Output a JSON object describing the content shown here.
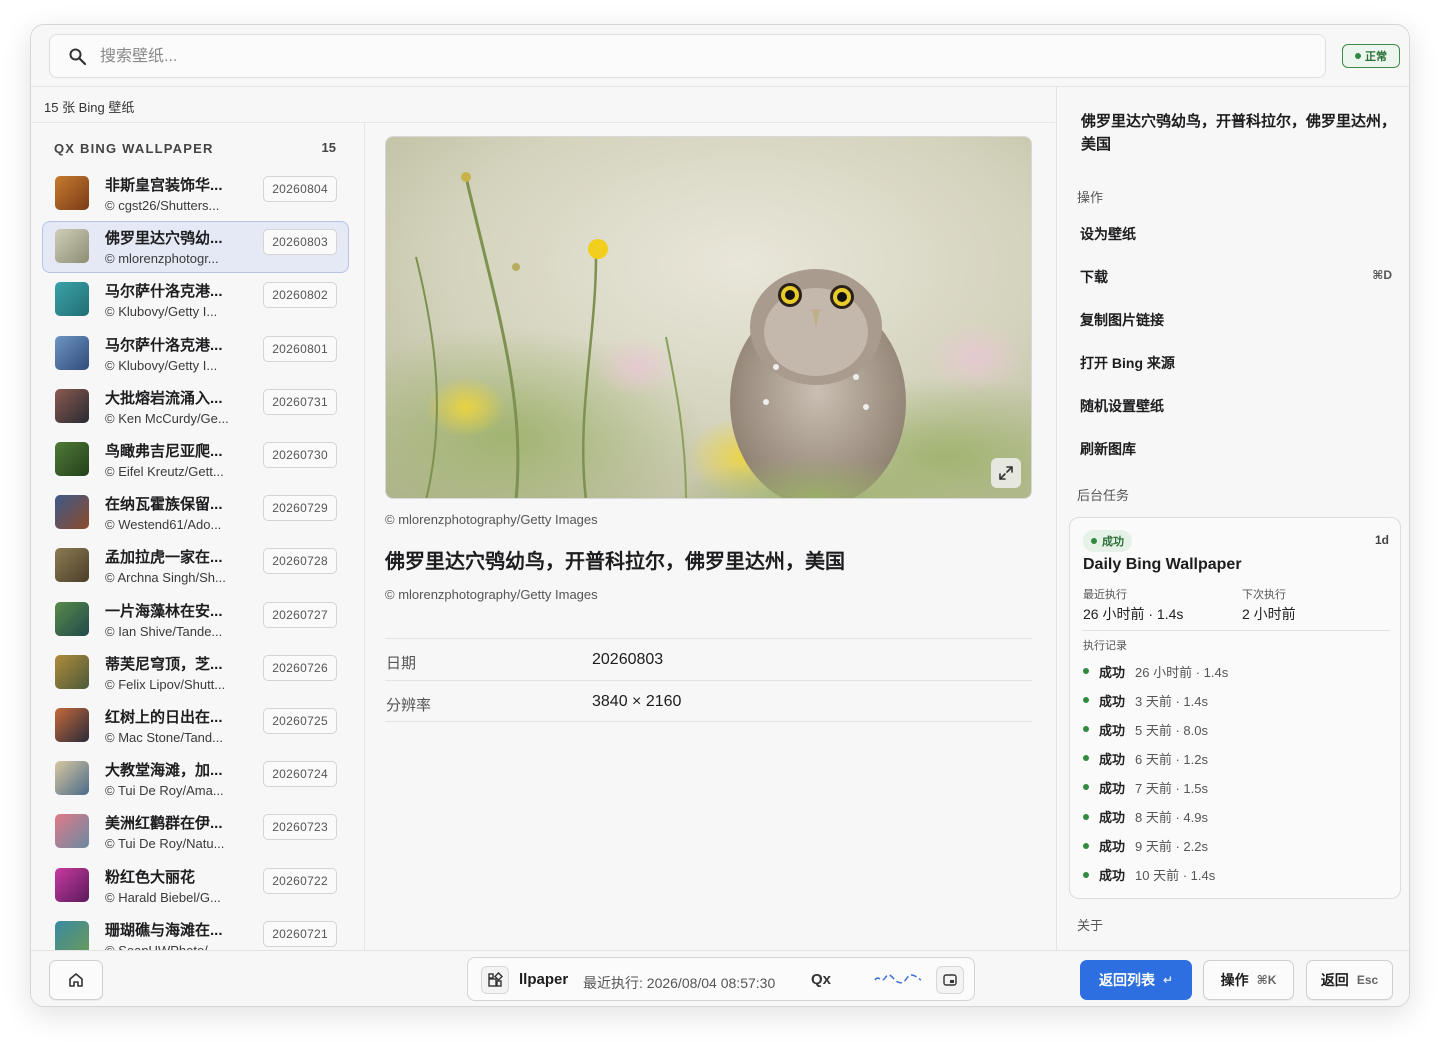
{
  "search": {
    "placeholder": "搜索壁纸..."
  },
  "status": {
    "label": "正常",
    "color": "#2f8a3f"
  },
  "list": {
    "count_label": "15 张 Bing 壁纸",
    "section_title": "QX BING WALLPAPER",
    "section_count": "15",
    "items": [
      {
        "title": "非斯皇宫装饰华...",
        "credit": "© cgst26/Shutters...",
        "date": "20260804",
        "thumb": [
          "#c77a2f",
          "#7a3b16"
        ]
      },
      {
        "title": "佛罗里达穴鸮幼...",
        "credit": "© mlorenzphotogr...",
        "date": "20260803",
        "thumb": [
          "#cfcfb8",
          "#8d8d74"
        ]
      },
      {
        "title": "马尔萨什洛克港...",
        "credit": "© Klubovy/Getty I...",
        "date": "20260802",
        "thumb": [
          "#39a3a8",
          "#226e74"
        ]
      },
      {
        "title": "马尔萨什洛克港...",
        "credit": "© Klubovy/Getty I...",
        "date": "20260801",
        "thumb": [
          "#6e95c3",
          "#2f4c7a"
        ]
      },
      {
        "title": "大批熔岩流涌入...",
        "credit": "© Ken McCurdy/Ge...",
        "date": "20260731",
        "thumb": [
          "#8a5a4f",
          "#2a2a33"
        ]
      },
      {
        "title": "鸟瞰弗吉尼亚爬...",
        "credit": "© Eifel Kreutz/Gett...",
        "date": "20260730",
        "thumb": [
          "#4f7a36",
          "#23401c"
        ]
      },
      {
        "title": "在纳瓦霍族保留...",
        "credit": "© Westend61/Ado...",
        "date": "20260729",
        "thumb": [
          "#3f5a8a",
          "#8a4a2a"
        ]
      },
      {
        "title": "孟加拉虎一家在...",
        "credit": "© Archna Singh/Sh...",
        "date": "20260728",
        "thumb": [
          "#8c7a52",
          "#4a3f2a"
        ]
      },
      {
        "title": "一片海藻林在安...",
        "credit": "© Ian Shive/Tande...",
        "date": "20260727",
        "thumb": [
          "#5a8a4a",
          "#1f4a4a"
        ]
      },
      {
        "title": "蒂芙尼穹顶，芝...",
        "credit": "© Felix Lipov/Shutt...",
        "date": "20260726",
        "thumb": [
          "#b08a3a",
          "#4a5a3a"
        ]
      },
      {
        "title": "红树上的日出在...",
        "credit": "© Mac Stone/Tand...",
        "date": "20260725",
        "thumb": [
          "#c46a3a",
          "#2a2a3a"
        ]
      },
      {
        "title": "大教堂海滩，加...",
        "credit": "© Tui De Roy/Ama...",
        "date": "20260724",
        "thumb": [
          "#d8c8a0",
          "#4a6a8a"
        ]
      },
      {
        "title": "美洲红鹳群在伊...",
        "credit": "© Tui De Roy/Natu...",
        "date": "20260723",
        "thumb": [
          "#e07a8a",
          "#6a8aa0"
        ]
      },
      {
        "title": "粉红色大丽花",
        "credit": "© Harald Biebel/G...",
        "date": "20260722",
        "thumb": [
          "#c83aa0",
          "#5a1a5a"
        ]
      },
      {
        "title": "珊瑚礁与海滩在...",
        "credit": "© SeanUWPhoto/...",
        "date": "20260721",
        "thumb": [
          "#3a8aa0",
          "#6a9a5a"
        ]
      }
    ]
  },
  "detail": {
    "photo_credit": "© mlorenzphotography/Getty Images",
    "title": "佛罗里达穴鸮幼鸟，开普科拉尔，佛罗里达州，美国",
    "credit": "© mlorenzphotography/Getty Images",
    "meta": [
      {
        "key": "日期",
        "value": "20260803"
      },
      {
        "key": "分辨率",
        "value": "3840 × 2160"
      }
    ],
    "expand_icon": "expand-icon"
  },
  "side": {
    "title": "佛罗里达穴鸮幼鸟，开普科拉尔，佛罗里达州，美国",
    "actions_label": "操作",
    "actions": [
      {
        "label": "设为壁纸",
        "shortcut": ""
      },
      {
        "label": "下载",
        "shortcut": "⌘D"
      },
      {
        "label": "复制图片链接",
        "shortcut": ""
      },
      {
        "label": "打开 Bing 来源",
        "shortcut": ""
      },
      {
        "label": "随机设置壁纸",
        "shortcut": ""
      },
      {
        "label": "刷新图库",
        "shortcut": ""
      }
    ],
    "tasks_label": "后台任务",
    "task": {
      "status": "成功",
      "interval": "1d",
      "name": "Daily Bing Wallpaper",
      "last_run_label": "最近执行",
      "last_run_value": "26 小时前 · 1.4s",
      "next_run_label": "下次执行",
      "next_run_value": "2 小时前",
      "history_label": "执行记录",
      "history": [
        {
          "status": "成功",
          "detail": "26 小时前 · 1.4s"
        },
        {
          "status": "成功",
          "detail": "3 天前 · 1.4s"
        },
        {
          "status": "成功",
          "detail": "5 天前 · 8.0s"
        },
        {
          "status": "成功",
          "detail": "6 天前 · 1.2s"
        },
        {
          "status": "成功",
          "detail": "7 天前 · 1.5s"
        },
        {
          "status": "成功",
          "detail": "8 天前 · 4.9s"
        },
        {
          "status": "成功",
          "detail": "9 天前 · 2.2s"
        },
        {
          "status": "成功",
          "detail": "10 天前 · 1.4s"
        }
      ]
    },
    "about_label": "关于"
  },
  "footer": {
    "app_name": "llpaper",
    "last_run": "最近执行: 2026/08/04 08:57:30",
    "brand": "Qx",
    "back_to_list": "返回列表",
    "back_to_list_key": "↵",
    "actions": "操作",
    "actions_key": "⌘K",
    "back": "返回",
    "back_key": "Esc",
    "accent_color": "#2d6ee0"
  }
}
